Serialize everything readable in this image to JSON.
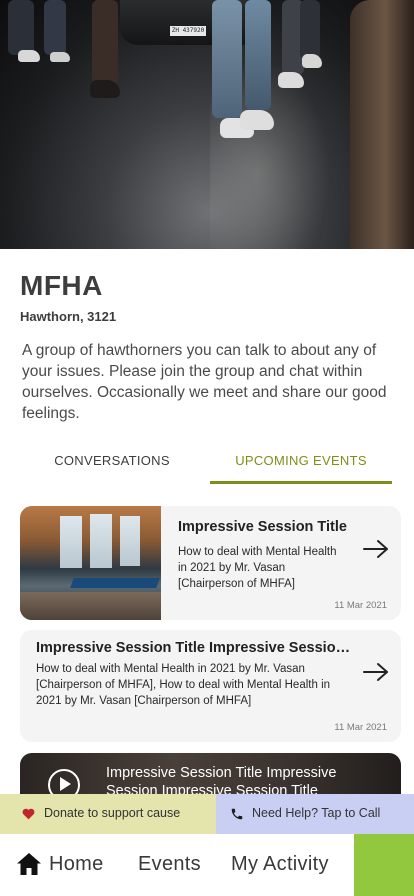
{
  "group": {
    "name": "MFHA",
    "location": "Hawthorn, 3121",
    "description": "A group of hawthorners you can talk to about any of your issues. Please join the group and chat within ourselves. Occasionally we meet and share our good feelings."
  },
  "hero": {
    "plate_text": "ZH 437920"
  },
  "tabs": [
    {
      "label": "CONVERSATIONS",
      "active": false
    },
    {
      "label": "UPCOMING EVENTS",
      "active": true
    }
  ],
  "events": [
    {
      "title": "Impressive Session Title",
      "body": "How to deal with Mental Health in 2021 by Mr. Vasan [Chairperson of MHFA]",
      "date": "11 Mar 2021",
      "icon": "arrow-right-icon"
    },
    {
      "title": "Impressive Session Title Impressive Session Title",
      "body": "How to deal with Mental Health in 2021 by Mr. Vasan [Chairperson of MHFA], How to deal with Mental Health in 2021 by Mr. Vasan [Chairperson of MHFA]",
      "date": "11 Mar 2021",
      "icon": "arrow-right-icon"
    },
    {
      "title": "Impressive Session Title Impressive Session Impressive Session Title",
      "icon": "play-icon"
    }
  ],
  "actions": {
    "donate_label": "Donate to support cause",
    "help_label": "Need Help? Tap to Call"
  },
  "nav": {
    "home": "Home",
    "events": "Events",
    "activity": "My Activity"
  },
  "colors": {
    "accent_green": "#7b8f1a",
    "nav_accent": "#92c83e",
    "donate_bg": "#e3e5ac",
    "help_bg": "#c9cff3",
    "heart": "#c0262d"
  }
}
